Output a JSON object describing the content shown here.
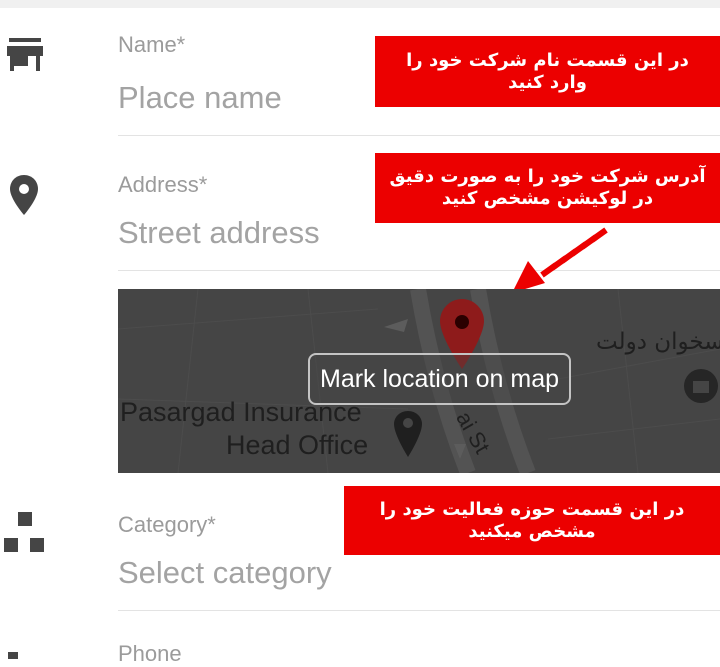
{
  "form": {
    "name": {
      "label": "Name*",
      "placeholder": "Place name",
      "icon": "storefront-icon"
    },
    "address": {
      "label": "Address*",
      "placeholder": "Street address",
      "icon": "location-pin-icon"
    },
    "map": {
      "button_label": "Mark location on map",
      "place_label_1": "Pasargad Insurance",
      "place_label_2": "Head Office",
      "rtl_place_label": "سخوان دولت",
      "street_label": "ai St"
    },
    "category": {
      "label": "Category*",
      "placeholder": "Select category",
      "icon": "category-icon"
    },
    "phone": {
      "label": "Phone",
      "icon": "phone-icon"
    }
  },
  "annotations": {
    "name_note": "در این قسمت نام شرکت خود را وارد کنید",
    "address_note": "آدرس شرکت خود را به صورت دقیق در لوکیشن مشخص کنید",
    "category_note": "در این قسمت حوزه فعالیت خود را مشخص میکنید"
  },
  "colors": {
    "annotation": "#ec0000",
    "map_pin": "#c62828",
    "icon": "#454545"
  }
}
